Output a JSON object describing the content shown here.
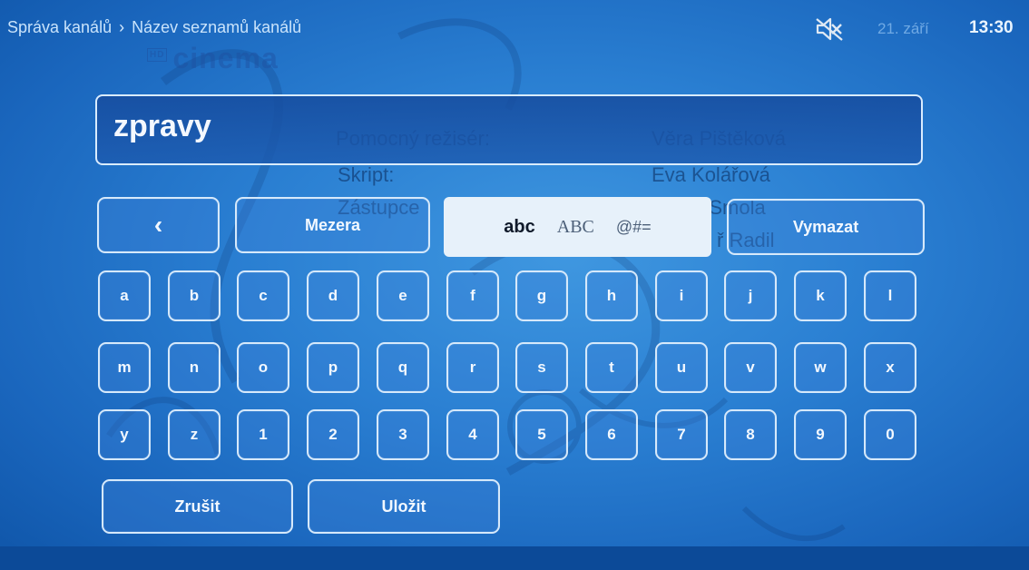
{
  "breadcrumb": {
    "items": [
      "Správa kanálů",
      "Název seznamů kanálů"
    ],
    "separator": "›"
  },
  "status": {
    "mute_icon": "mute-icon",
    "date": "21. září",
    "time": "13:30"
  },
  "input": {
    "value": "zpravy"
  },
  "controls": {
    "back_label": "‹",
    "space_label": "Mezera",
    "delete_label": "Vymazat",
    "modes": [
      {
        "label": "abc",
        "active": true
      },
      {
        "label": "ABC",
        "active": false
      },
      {
        "label": "@#=",
        "active": false
      }
    ]
  },
  "keyboard": {
    "rows": [
      [
        "a",
        "b",
        "c",
        "d",
        "e",
        "f",
        "g",
        "h",
        "i",
        "j",
        "k",
        "l"
      ],
      [
        "m",
        "n",
        "o",
        "p",
        "q",
        "r",
        "s",
        "t",
        "u",
        "v",
        "w",
        "x"
      ],
      [
        "y",
        "z",
        "1",
        "2",
        "3",
        "4",
        "5",
        "6",
        "7",
        "8",
        "9",
        "0"
      ]
    ]
  },
  "actions": {
    "cancel_label": "Zrušit",
    "save_label": "Uložit"
  },
  "background": {
    "logo_text": "cinema",
    "credits": [
      [
        "Pomocný režisér:",
        "Věra Pištěková"
      ],
      [
        "Skript:",
        "Eva Kolářová"
      ],
      [
        "Zástupce",
        "av Smola"
      ],
      [
        "",
        "ř Radil"
      ]
    ]
  },
  "colors": {
    "accent_border": "#d6e9fb",
    "overlay_blue": "#2a7fd2",
    "mode_bg": "#e7f1fa"
  }
}
